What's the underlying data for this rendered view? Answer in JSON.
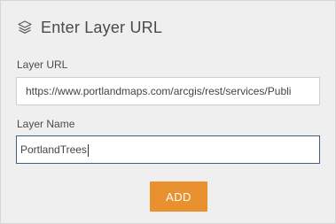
{
  "header": {
    "title": "Enter Layer URL",
    "icon": "layers-icon"
  },
  "form": {
    "layer_url_label": "Layer URL",
    "layer_url_value": "https://www.portlandmaps.com/arcgis/rest/services/Publi",
    "layer_name_label": "Layer Name",
    "layer_name_value": "PortlandTrees",
    "add_button_label": "ADD"
  },
  "colors": {
    "panel_background": "#efefef",
    "button_accent": "#e8912e",
    "focused_border": "#3e5f86"
  }
}
